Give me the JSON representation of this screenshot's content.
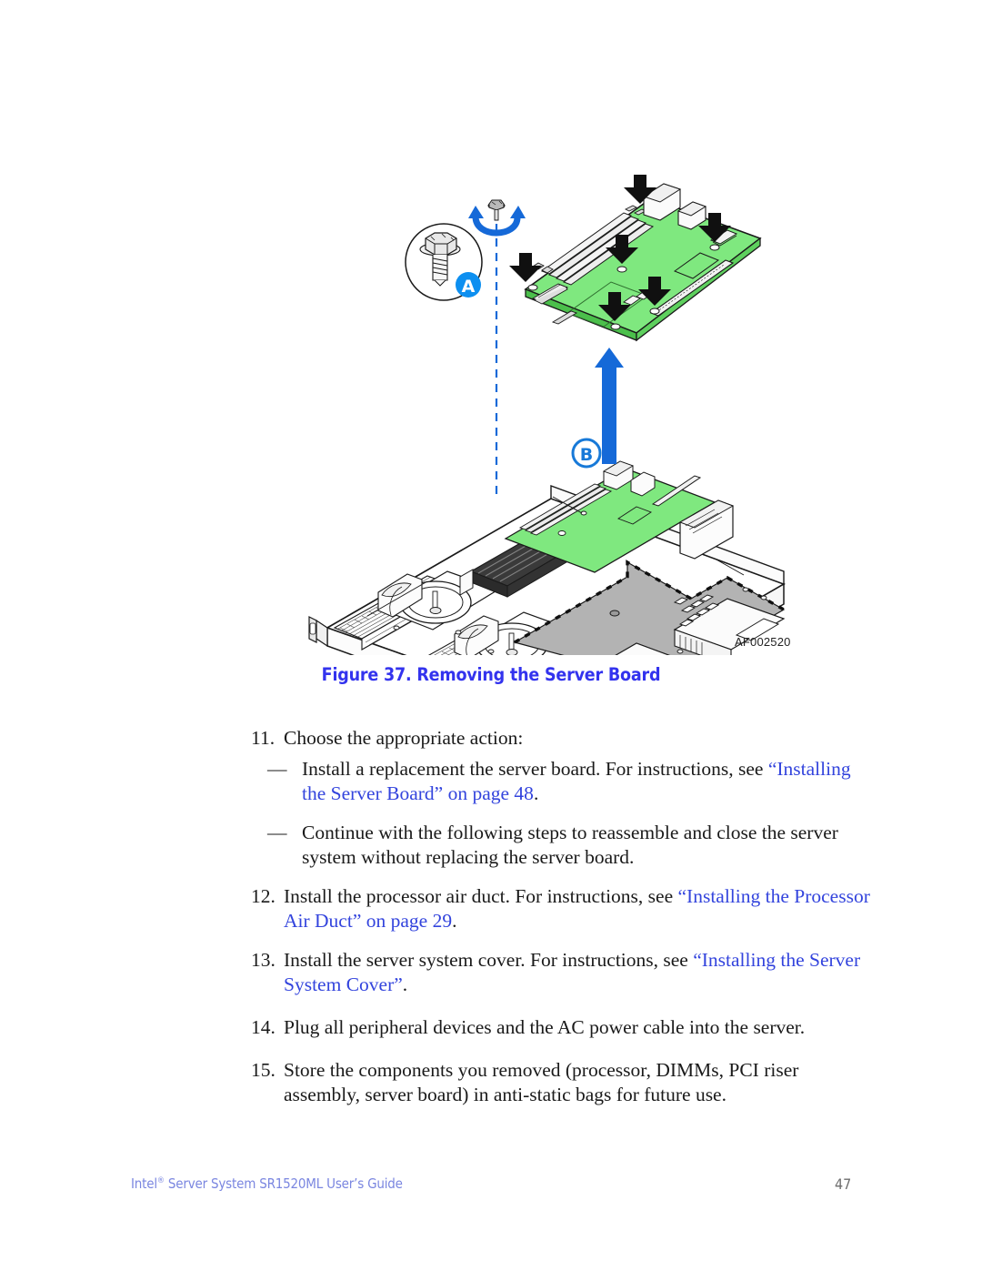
{
  "page": {
    "number": "47",
    "footer_title_main": "Intel",
    "footer_title_mark": "®",
    "footer_title_rest": " Server System SR1520ML User’s Guide"
  },
  "figure": {
    "id_label": "AF002520",
    "caption": "Figure 37. Removing the Server Board",
    "callouts": [
      {
        "id": "A",
        "label": "A",
        "meaning": "screw-detail-callout"
      },
      {
        "id": "B",
        "label": "B",
        "meaning": "lift-server-board-callout"
      }
    ],
    "colors": {
      "pcb_green": "#7fe87f",
      "pcb_green_dark": "#4bbf4b",
      "callout_blue_fill": "#0d8ff0",
      "callout_blue_stroke": "#1779d8",
      "arrow_blue": "#1569d8",
      "tray_gray": "#b3b3b3",
      "heatsink_dark": "#3a3a3a",
      "line_black": "#1a1a1a"
    },
    "description": "Exploded isometric view of a 1U rack server chassis with the server board being removed upward; magnified screw detail in circle labeled A, rotation arrow indicating unscrewing, large blue upward arrow labeled B indicating board removal direction."
  },
  "steps": [
    {
      "kind": "numbered",
      "num": "11.",
      "segments": [
        {
          "text": "Choose the appropriate action:",
          "link": false
        }
      ]
    },
    {
      "kind": "sub",
      "dash": "—",
      "segments": [
        {
          "text": "Install a replacement the server board. For instructions, see ",
          "link": false
        },
        {
          "text": "“Installing the Server Board” on page 48",
          "link": true
        },
        {
          "text": ".",
          "link": false
        }
      ]
    },
    {
      "kind": "sub",
      "dash": "—",
      "segments": [
        {
          "text": "Continue with the following steps to reassemble and close the server system without replacing the server board.",
          "link": false
        }
      ]
    },
    {
      "kind": "numbered",
      "num": "12.",
      "segments": [
        {
          "text": "Install the processor air duct. For instructions, see ",
          "link": false
        },
        {
          "text": "“Installing the Processor Air Duct” on page 29",
          "link": true
        },
        {
          "text": ".",
          "link": false
        }
      ]
    },
    {
      "kind": "numbered",
      "num": "13.",
      "segments": [
        {
          "text": "Install the server system cover. For instructions, see ",
          "link": false
        },
        {
          "text": "“Installing the Server System Cover”",
          "link": true
        },
        {
          "text": ".",
          "link": false
        }
      ]
    },
    {
      "kind": "numbered",
      "num": "14.",
      "segments": [
        {
          "text": "Plug all peripheral devices and the AC power cable into the server.",
          "link": false
        }
      ]
    },
    {
      "kind": "numbered",
      "num": "15.",
      "segments": [
        {
          "text": "Store the components you removed (processor, DIMMs, PCI riser assembly, server board) in anti-static bags for future use.",
          "link": false
        }
      ]
    }
  ]
}
